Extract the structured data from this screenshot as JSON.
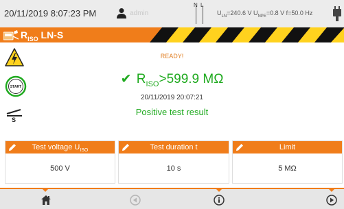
{
  "status_bar": {
    "datetime": "20/11/2019 8:07:23 PM",
    "user": "admin",
    "n_label": "N",
    "l_label": "L",
    "readings": {
      "uln_label": "U",
      "uln_sub": "LN",
      "uln_value": "=240.6 V",
      "unpe_label": "U",
      "unpe_sub": "NPE",
      "unpe_value": "=0.8 V",
      "freq": "f=50.0 Hz"
    }
  },
  "title_bar": {
    "r": "R",
    "sub": "ISO",
    "rest": " LN-S"
  },
  "result": {
    "status": "READY!",
    "symbol": "R",
    "symbol_sub": "ISO",
    "value": ">599.9 MΩ",
    "timestamp": "20/11/2019 20:07:21",
    "message": "Positive test result"
  },
  "panels": [
    {
      "label": "Test voltage U",
      "label_sub": "ISO",
      "value": "500 V"
    },
    {
      "label": "Test duration t",
      "value": "10 s"
    },
    {
      "label": "Limit",
      "value": "5 MΩ"
    }
  ],
  "colors": {
    "accent": "#f07d1a",
    "ok": "#1faa1f",
    "ready": "#e07b1c"
  },
  "icons": {
    "home": "home-icon",
    "back": "back-icon",
    "info": "info-icon",
    "next": "next-icon"
  }
}
